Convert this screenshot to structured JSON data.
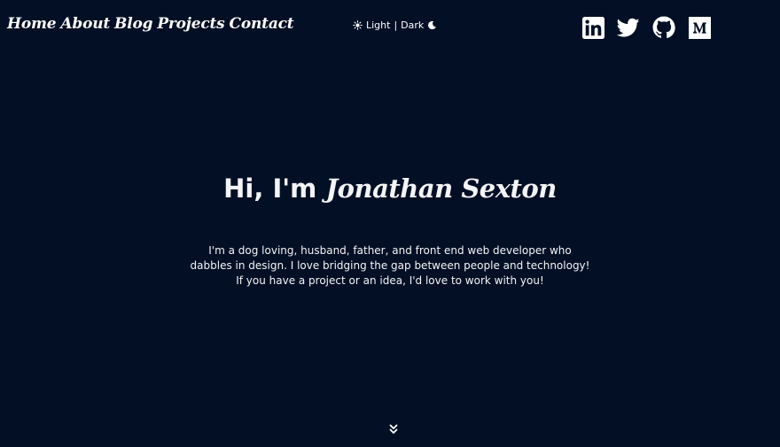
{
  "nav": {
    "items": [
      {
        "label": "Home"
      },
      {
        "label": "About"
      },
      {
        "label": "Blog"
      },
      {
        "label": "Projects"
      },
      {
        "label": "Contact"
      }
    ]
  },
  "theme_toggle": {
    "light_icon": "sun-icon",
    "light_label": "Light",
    "separator": "|",
    "dark_label": "Dark",
    "dark_icon": "moon-icon"
  },
  "social": {
    "icons": [
      "linkedin-icon",
      "twitter-icon",
      "github-icon",
      "medium-icon"
    ]
  },
  "hero": {
    "greeting": "Hi, I'm ",
    "name": "Jonathan Sexton",
    "bio": "I'm a dog loving, husband, father, and front end web developer who dabbles in design. I love bridging the gap between people and technology! If you have a project or an idea, I'd love to work with you!"
  },
  "scroll_icon": "double-chevron-down-icon",
  "colors": {
    "background": "#020f24",
    "text": "#ffffff"
  }
}
